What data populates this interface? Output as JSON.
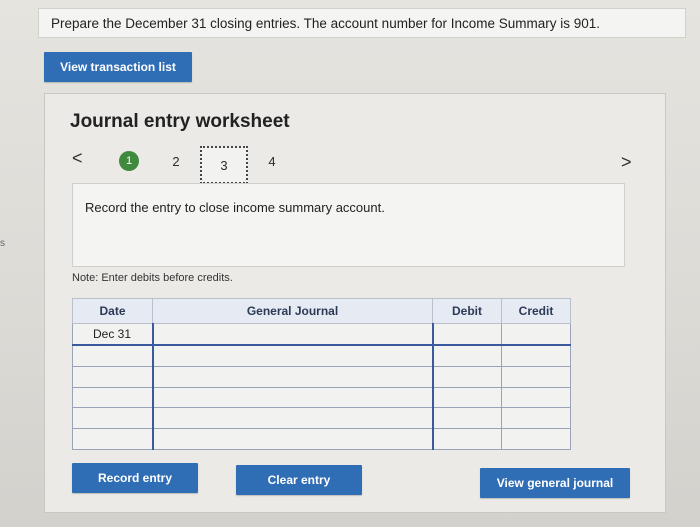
{
  "prompt": "Prepare the December 31 closing entries. The account number for Income Summary is 901.",
  "buttons": {
    "view_transaction_list": "View transaction list",
    "record_entry": "Record entry",
    "clear_entry": "Clear entry",
    "view_general_journal": "View general journal"
  },
  "worksheet": {
    "title": "Journal entry worksheet",
    "nav_prev": "<",
    "nav_next": ">",
    "steps": [
      "1",
      "2",
      "3",
      "4"
    ],
    "instruction": "Record the entry to close income summary account.",
    "note": "Note: Enter debits before credits."
  },
  "journal": {
    "headers": [
      "Date",
      "General Journal",
      "Debit",
      "Credit"
    ],
    "rows": [
      [
        "Dec 31",
        "",
        "",
        ""
      ],
      [
        "",
        "",
        "",
        ""
      ],
      [
        "",
        "",
        "",
        ""
      ],
      [
        "",
        "",
        "",
        ""
      ],
      [
        "",
        "",
        "",
        ""
      ],
      [
        "",
        "",
        "",
        ""
      ]
    ]
  },
  "edge_mark": "s",
  "colors": {
    "button": "#2f6db5",
    "step_active": "#3f8a3c"
  }
}
